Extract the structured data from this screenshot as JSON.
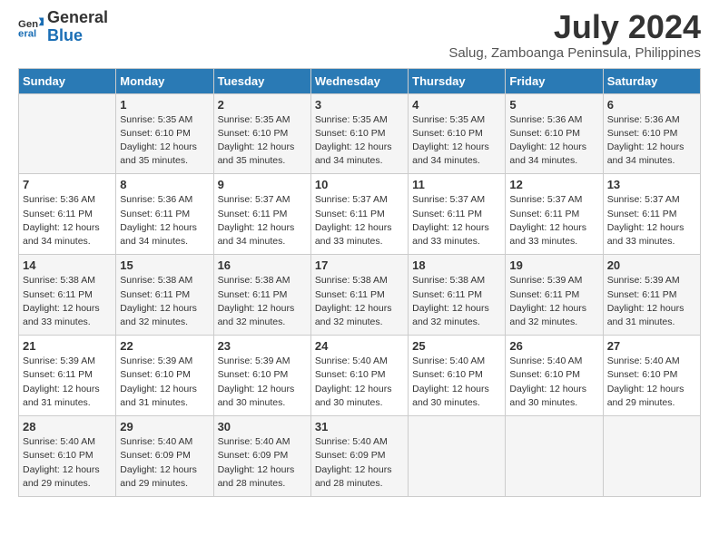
{
  "logo": {
    "line1": "General",
    "line2": "Blue"
  },
  "title": "July 2024",
  "subtitle": "Salug, Zamboanga Peninsula, Philippines",
  "days_of_week": [
    "Sunday",
    "Monday",
    "Tuesday",
    "Wednesday",
    "Thursday",
    "Friday",
    "Saturday"
  ],
  "weeks": [
    [
      {
        "day": "",
        "sunrise": "",
        "sunset": "",
        "daylight": ""
      },
      {
        "day": "1",
        "sunrise": "Sunrise: 5:35 AM",
        "sunset": "Sunset: 6:10 PM",
        "daylight": "Daylight: 12 hours and 35 minutes."
      },
      {
        "day": "2",
        "sunrise": "Sunrise: 5:35 AM",
        "sunset": "Sunset: 6:10 PM",
        "daylight": "Daylight: 12 hours and 35 minutes."
      },
      {
        "day": "3",
        "sunrise": "Sunrise: 5:35 AM",
        "sunset": "Sunset: 6:10 PM",
        "daylight": "Daylight: 12 hours and 34 minutes."
      },
      {
        "day": "4",
        "sunrise": "Sunrise: 5:35 AM",
        "sunset": "Sunset: 6:10 PM",
        "daylight": "Daylight: 12 hours and 34 minutes."
      },
      {
        "day": "5",
        "sunrise": "Sunrise: 5:36 AM",
        "sunset": "Sunset: 6:10 PM",
        "daylight": "Daylight: 12 hours and 34 minutes."
      },
      {
        "day": "6",
        "sunrise": "Sunrise: 5:36 AM",
        "sunset": "Sunset: 6:10 PM",
        "daylight": "Daylight: 12 hours and 34 minutes."
      }
    ],
    [
      {
        "day": "7",
        "sunrise": "Sunrise: 5:36 AM",
        "sunset": "Sunset: 6:11 PM",
        "daylight": "Daylight: 12 hours and 34 minutes."
      },
      {
        "day": "8",
        "sunrise": "Sunrise: 5:36 AM",
        "sunset": "Sunset: 6:11 PM",
        "daylight": "Daylight: 12 hours and 34 minutes."
      },
      {
        "day": "9",
        "sunrise": "Sunrise: 5:37 AM",
        "sunset": "Sunset: 6:11 PM",
        "daylight": "Daylight: 12 hours and 34 minutes."
      },
      {
        "day": "10",
        "sunrise": "Sunrise: 5:37 AM",
        "sunset": "Sunset: 6:11 PM",
        "daylight": "Daylight: 12 hours and 33 minutes."
      },
      {
        "day": "11",
        "sunrise": "Sunrise: 5:37 AM",
        "sunset": "Sunset: 6:11 PM",
        "daylight": "Daylight: 12 hours and 33 minutes."
      },
      {
        "day": "12",
        "sunrise": "Sunrise: 5:37 AM",
        "sunset": "Sunset: 6:11 PM",
        "daylight": "Daylight: 12 hours and 33 minutes."
      },
      {
        "day": "13",
        "sunrise": "Sunrise: 5:37 AM",
        "sunset": "Sunset: 6:11 PM",
        "daylight": "Daylight: 12 hours and 33 minutes."
      }
    ],
    [
      {
        "day": "14",
        "sunrise": "Sunrise: 5:38 AM",
        "sunset": "Sunset: 6:11 PM",
        "daylight": "Daylight: 12 hours and 33 minutes."
      },
      {
        "day": "15",
        "sunrise": "Sunrise: 5:38 AM",
        "sunset": "Sunset: 6:11 PM",
        "daylight": "Daylight: 12 hours and 32 minutes."
      },
      {
        "day": "16",
        "sunrise": "Sunrise: 5:38 AM",
        "sunset": "Sunset: 6:11 PM",
        "daylight": "Daylight: 12 hours and 32 minutes."
      },
      {
        "day": "17",
        "sunrise": "Sunrise: 5:38 AM",
        "sunset": "Sunset: 6:11 PM",
        "daylight": "Daylight: 12 hours and 32 minutes."
      },
      {
        "day": "18",
        "sunrise": "Sunrise: 5:38 AM",
        "sunset": "Sunset: 6:11 PM",
        "daylight": "Daylight: 12 hours and 32 minutes."
      },
      {
        "day": "19",
        "sunrise": "Sunrise: 5:39 AM",
        "sunset": "Sunset: 6:11 PM",
        "daylight": "Daylight: 12 hours and 32 minutes."
      },
      {
        "day": "20",
        "sunrise": "Sunrise: 5:39 AM",
        "sunset": "Sunset: 6:11 PM",
        "daylight": "Daylight: 12 hours and 31 minutes."
      }
    ],
    [
      {
        "day": "21",
        "sunrise": "Sunrise: 5:39 AM",
        "sunset": "Sunset: 6:11 PM",
        "daylight": "Daylight: 12 hours and 31 minutes."
      },
      {
        "day": "22",
        "sunrise": "Sunrise: 5:39 AM",
        "sunset": "Sunset: 6:10 PM",
        "daylight": "Daylight: 12 hours and 31 minutes."
      },
      {
        "day": "23",
        "sunrise": "Sunrise: 5:39 AM",
        "sunset": "Sunset: 6:10 PM",
        "daylight": "Daylight: 12 hours and 30 minutes."
      },
      {
        "day": "24",
        "sunrise": "Sunrise: 5:40 AM",
        "sunset": "Sunset: 6:10 PM",
        "daylight": "Daylight: 12 hours and 30 minutes."
      },
      {
        "day": "25",
        "sunrise": "Sunrise: 5:40 AM",
        "sunset": "Sunset: 6:10 PM",
        "daylight": "Daylight: 12 hours and 30 minutes."
      },
      {
        "day": "26",
        "sunrise": "Sunrise: 5:40 AM",
        "sunset": "Sunset: 6:10 PM",
        "daylight": "Daylight: 12 hours and 30 minutes."
      },
      {
        "day": "27",
        "sunrise": "Sunrise: 5:40 AM",
        "sunset": "Sunset: 6:10 PM",
        "daylight": "Daylight: 12 hours and 29 minutes."
      }
    ],
    [
      {
        "day": "28",
        "sunrise": "Sunrise: 5:40 AM",
        "sunset": "Sunset: 6:10 PM",
        "daylight": "Daylight: 12 hours and 29 minutes."
      },
      {
        "day": "29",
        "sunrise": "Sunrise: 5:40 AM",
        "sunset": "Sunset: 6:09 PM",
        "daylight": "Daylight: 12 hours and 29 minutes."
      },
      {
        "day": "30",
        "sunrise": "Sunrise: 5:40 AM",
        "sunset": "Sunset: 6:09 PM",
        "daylight": "Daylight: 12 hours and 28 minutes."
      },
      {
        "day": "31",
        "sunrise": "Sunrise: 5:40 AM",
        "sunset": "Sunset: 6:09 PM",
        "daylight": "Daylight: 12 hours and 28 minutes."
      },
      {
        "day": "",
        "sunrise": "",
        "sunset": "",
        "daylight": ""
      },
      {
        "day": "",
        "sunrise": "",
        "sunset": "",
        "daylight": ""
      },
      {
        "day": "",
        "sunrise": "",
        "sunset": "",
        "daylight": ""
      }
    ]
  ]
}
